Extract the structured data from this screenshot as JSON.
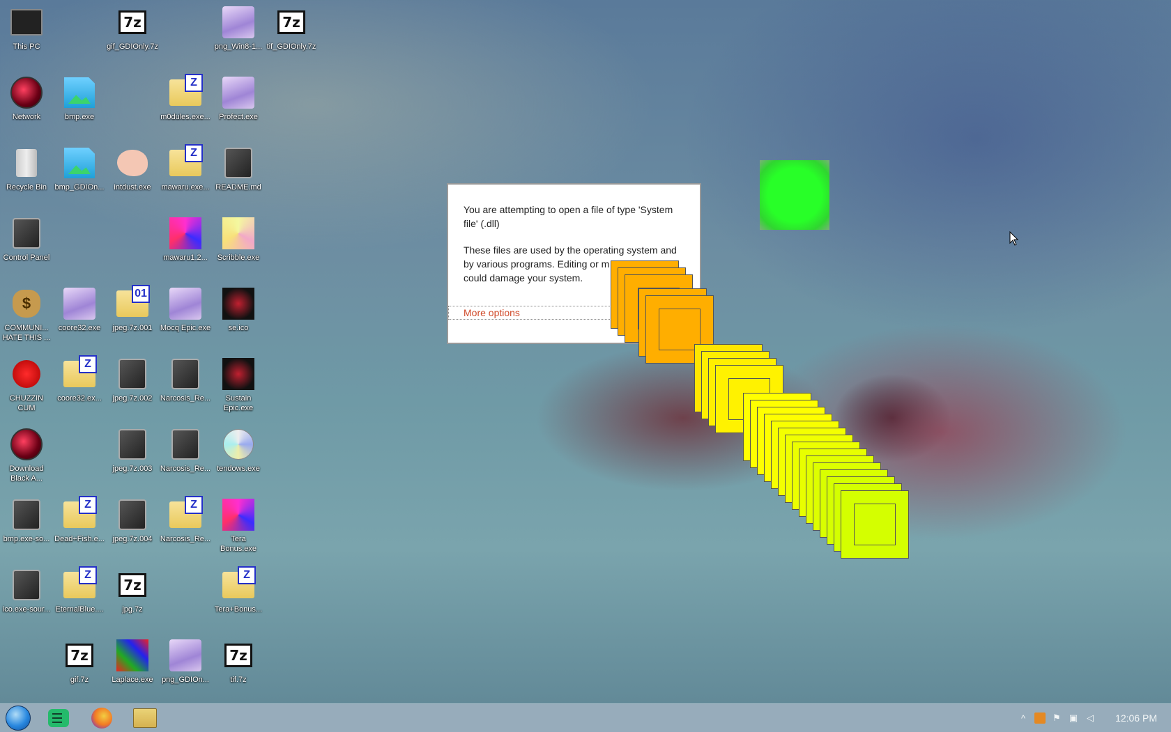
{
  "desktop_icons": {
    "this_pc": "This PC",
    "gif_gdionly_7z": "gif_GDIOnly.7z",
    "png_win8": "png_Win8-1...",
    "tif_gdionly_7z": "tif_GDIOnly.7z",
    "network": "Network",
    "bmp_exe": "bmp.exe",
    "m0dules_exe": "m0dules.exe...",
    "profect_exe": "Profect.exe",
    "recycle_bin": "Recycle Bin",
    "bmp_gdion": "bmp_GDIOn...",
    "intdust_exe": "intdust.exe",
    "mawaru_exe": "mawaru.exe...",
    "readme_md": "README.md",
    "control_panel": "Control Panel",
    "mawaru12": "mawaru1.2...",
    "scribble_exe": "Scribble.exe",
    "communi": "COMMUNI... HATE THIS ...",
    "coore32_exe": "coore32.exe",
    "jpeg_7z_001": "jpeg.7z.001",
    "mocq_epic_exe": "Mocq Epic.exe",
    "se_ico": "se.ico",
    "chuzzin_cum": "CHUZZIN CUM",
    "coore32_ex": "coore32.ex...",
    "jpeg_7z_002": "jpeg.7z.002",
    "narcosis_re_1": "Narcosis_Re...",
    "sustain_epic": "Sustain Epic.exe",
    "download_black": "Download Black A...",
    "jpeg_7z_003": "jpeg.7z.003",
    "narcosis_re_2": "Narcosis_Re...",
    "tendows_exe": "tendows.exe",
    "bmp_exe_so": "bmp.exe-so...",
    "deadfish": "Dead+Fish.e...",
    "jpeg_7z_004": "jpeg.7z.004",
    "narcosis_re_3": "Narcosis_Re...",
    "tera_bonus_exe": "Tera Bonus.exe",
    "ico_exe_sour": "ico.exe-sour...",
    "eternalblue": "EternalBlue....",
    "jpg_7z": "jpg.7z",
    "tera_bonus_2": "Tera+Bonus...",
    "gif_7z": "gif.7z",
    "laplace_exe": "Laplace.exe",
    "png_gdion": "png_GDIOn...",
    "tif_7z": "tif.7z"
  },
  "dialog": {
    "line1": "You are attempting to open a file of type 'System file' (.dll)",
    "line2": "These files are used by the operating system and by various programs. Editing or m",
    "line3": "could damage your system.",
    "more_options": "More options"
  },
  "colors": {
    "orange": "#ffae00",
    "yellow": "#ffff00",
    "lime": "#d4ff00",
    "green": "#22ff22",
    "link": "#d04a2a"
  },
  "taskbar": {
    "clock": "12:06 PM"
  }
}
